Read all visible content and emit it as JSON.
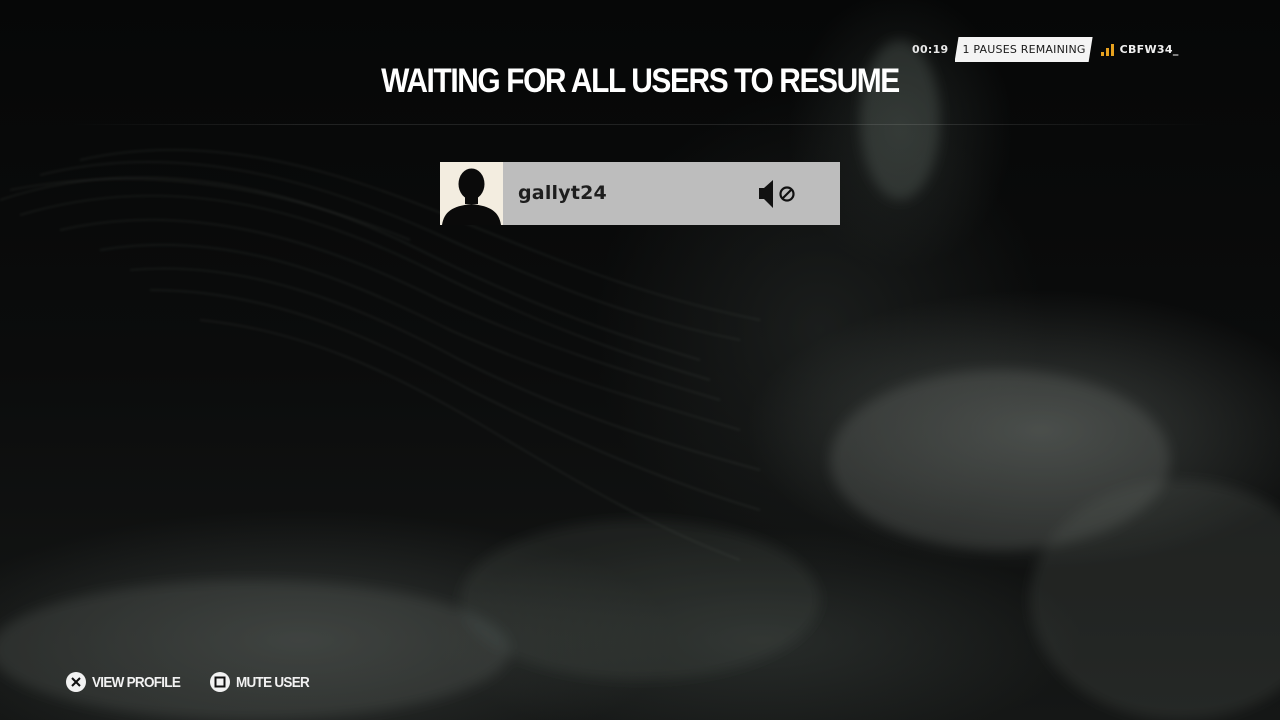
{
  "status": {
    "timer": "00:19",
    "pauses_remaining": "1 PAUSES REMAINING",
    "session_id": "CBFW34_",
    "signal_color": "#e7a21f"
  },
  "header": {
    "title": "WAITING FOR ALL USERS TO RESUME"
  },
  "players": [
    {
      "name": "gallyt24",
      "avatar_icon": "silhouette-avatar",
      "status_icon": "speaker-muted-icon"
    }
  ],
  "prompts": [
    {
      "button_icon": "cross-button-icon",
      "label": "VIEW PROFILE"
    },
    {
      "button_icon": "square-button-icon",
      "label": "MUTE USER"
    }
  ],
  "colors": {
    "card_background": "#bdbdbd",
    "avatar_background": "#f3ede0",
    "badge_background": "#f4f4f4"
  }
}
